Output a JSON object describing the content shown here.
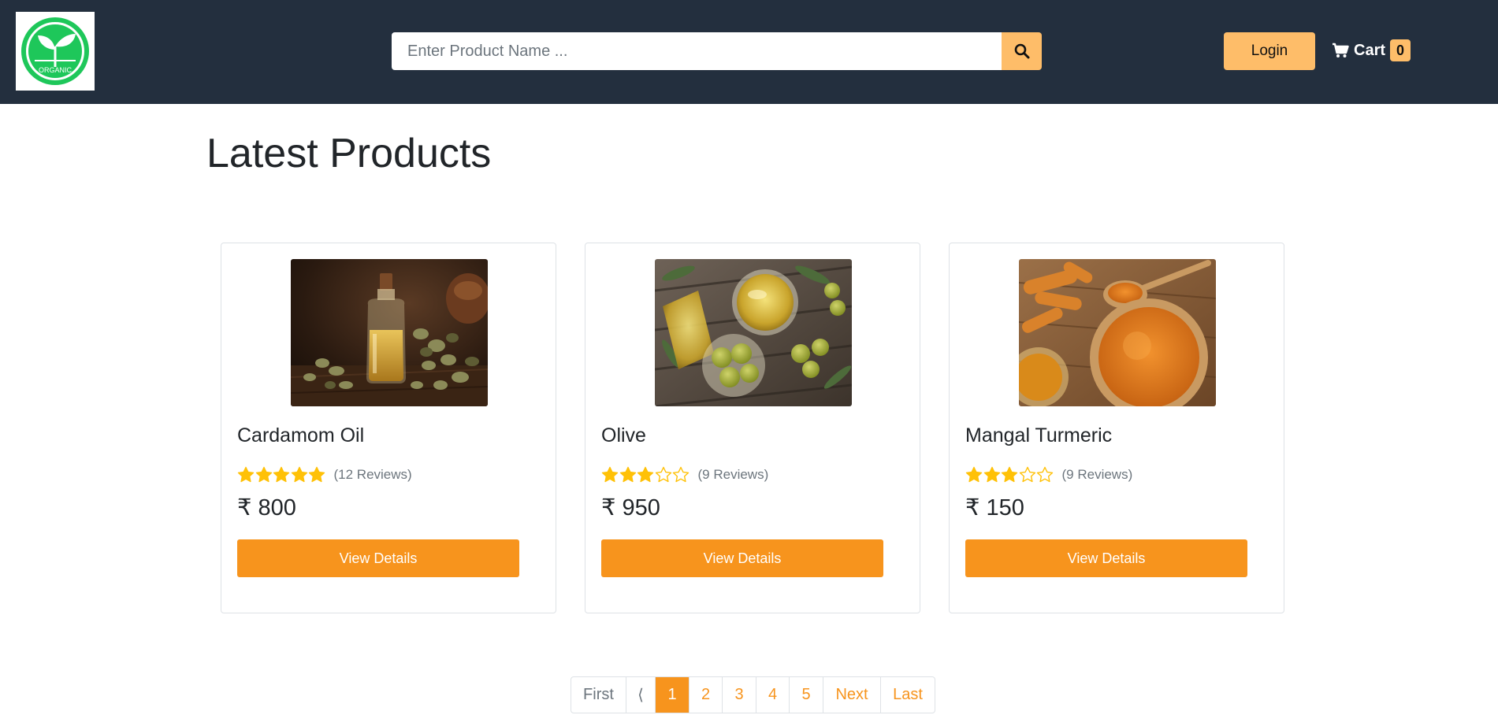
{
  "header": {
    "logo_text": "ORGANIC",
    "search": {
      "placeholder": "Enter Product Name ...",
      "value": ""
    },
    "login_label": "Login",
    "cart_label": "Cart",
    "cart_count": "0"
  },
  "main": {
    "title": "Latest Products",
    "products": [
      {
        "name": "Cardamom Oil",
        "rating": 5,
        "reviews": "(12 Reviews)",
        "price": "₹ 800",
        "button": "View Details"
      },
      {
        "name": "Olive",
        "rating": 3,
        "reviews": "(9 Reviews)",
        "price": "₹ 950",
        "button": "View Details"
      },
      {
        "name": "Mangal Turmeric",
        "rating": 3,
        "reviews": "(9 Reviews)",
        "price": "₹ 150",
        "button": "View Details"
      }
    ]
  },
  "pagination": {
    "first": "First",
    "prev": "⟨",
    "pages": [
      "1",
      "2",
      "3",
      "4",
      "5"
    ],
    "active_page": "1",
    "next": "Next",
    "last": "Last"
  },
  "colors": {
    "navbar": "#232f3e",
    "accent": "#febd69",
    "button": "#f7941d",
    "star": "#ffc107"
  }
}
